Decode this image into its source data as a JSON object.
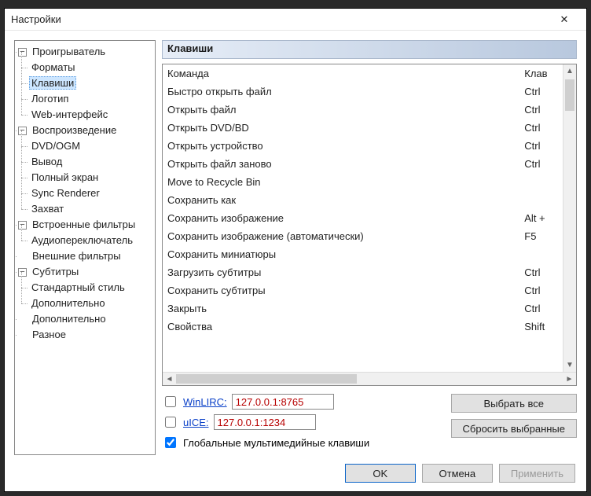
{
  "title": "Настройки",
  "close_glyph": "✕",
  "tree": {
    "player": {
      "label": "Проигрыватель",
      "expanded": true,
      "children": [
        {
          "label": "Форматы"
        },
        {
          "label": "Клавиши",
          "selected": true
        },
        {
          "label": "Логотип"
        },
        {
          "label": "Web-интерфейс"
        }
      ]
    },
    "playback": {
      "label": "Воспроизведение",
      "expanded": true,
      "children": [
        {
          "label": "DVD/OGM"
        },
        {
          "label": "Вывод"
        },
        {
          "label": "Полный экран"
        },
        {
          "label": "Sync Renderer"
        },
        {
          "label": "Захват"
        }
      ]
    },
    "filters_int": {
      "label": "Встроенные фильтры",
      "expanded": true,
      "children": [
        {
          "label": "Аудиопереключатель"
        }
      ]
    },
    "filters_ext": {
      "label": "Внешние фильтры",
      "children": []
    },
    "subs": {
      "label": "Субтитры",
      "expanded": true,
      "children": [
        {
          "label": "Стандартный стиль"
        },
        {
          "label": "Дополнительно"
        }
      ]
    },
    "extra": {
      "label": "Дополнительно",
      "children": []
    },
    "misc": {
      "label": "Разное",
      "children": []
    }
  },
  "section_title": "Клавиши",
  "table": {
    "headers": {
      "command": "Команда",
      "key": "Клав"
    },
    "rows": [
      {
        "cmd": "Быстро открыть файл",
        "key": "Ctrl"
      },
      {
        "cmd": "Открыть файл",
        "key": "Ctrl"
      },
      {
        "cmd": "Открыть DVD/BD",
        "key": "Ctrl"
      },
      {
        "cmd": "Открыть устройство",
        "key": "Ctrl"
      },
      {
        "cmd": "Открыть файл заново",
        "key": "Ctrl"
      },
      {
        "cmd": "Move to Recycle Bin",
        "key": ""
      },
      {
        "cmd": "Сохранить как",
        "key": ""
      },
      {
        "cmd": "Сохранить изображение",
        "key": "Alt +"
      },
      {
        "cmd": "Сохранить изображение (автоматически)",
        "key": "F5"
      },
      {
        "cmd": "Сохранить миниатюры",
        "key": ""
      },
      {
        "cmd": "Загрузить субтитры",
        "key": "Ctrl"
      },
      {
        "cmd": "Сохранить субтитры",
        "key": "Ctrl"
      },
      {
        "cmd": "Закрыть",
        "key": "Ctrl"
      },
      {
        "cmd": "Свойства",
        "key": "Shift"
      }
    ]
  },
  "options": {
    "winlirc_label": "WinLIRC:",
    "winlirc_value": "127.0.0.1:8765",
    "uice_label": "uICE:",
    "uice_value": "127.0.0.1:1234",
    "global_keys_label": "Глобальные мультимедийные клавиши"
  },
  "buttons": {
    "select_all": "Выбрать все",
    "reset_selected": "Сбросить выбранные",
    "ok": "OK",
    "cancel": "Отмена",
    "apply": "Применить"
  }
}
